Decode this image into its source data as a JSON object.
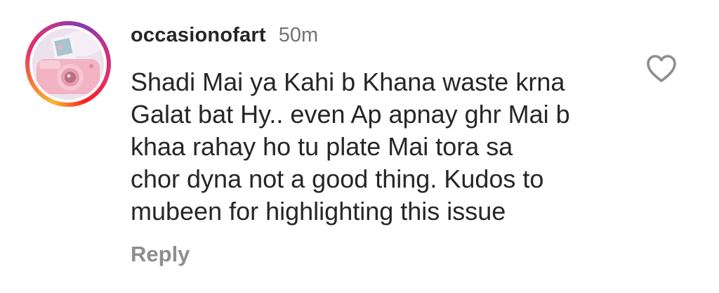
{
  "comment": {
    "username": "occasionofart",
    "timestamp": "50m",
    "text": "Shadi Mai ya Kahi b Khana waste krna\nGalat bat Hy.. even Ap apnay ghr Mai b\nkhaa rahay ho tu plate Mai tora sa\nchor dyna not a good thing.  Kudos to\nmubeen for highlighting this issue",
    "reply_label": "Reply",
    "like_icon": "heart-outline-icon",
    "avatar_ring_colors": [
      "#f7b733",
      "#f77737",
      "#e1306c",
      "#c13584",
      "#833ab4"
    ]
  }
}
